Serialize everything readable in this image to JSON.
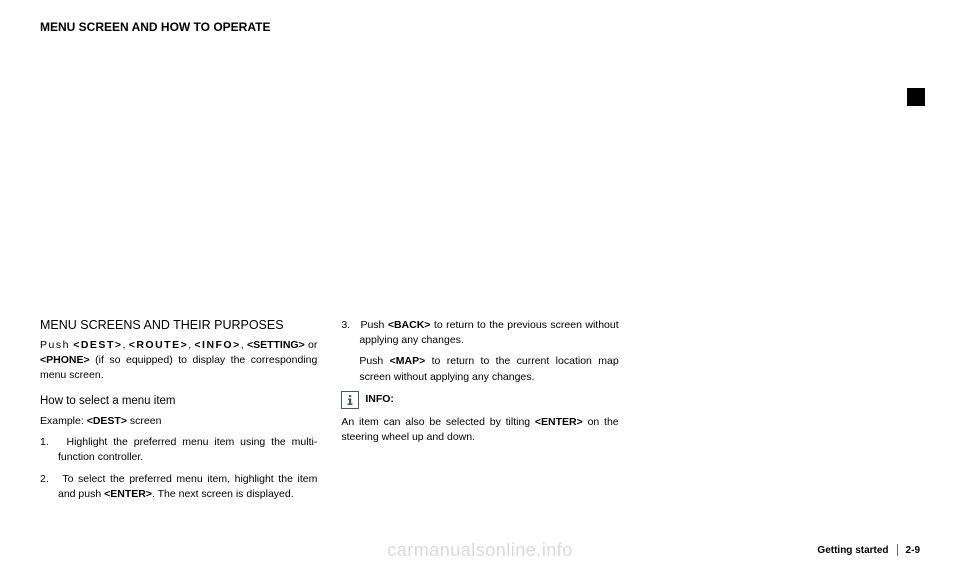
{
  "pageTitle": "MENU SCREEN AND HOW TO OPERATE",
  "col1": {
    "heading": "MENU SCREENS AND THEIR PURPOSES",
    "intro_push": "Push",
    "btn_dest": "<DEST>",
    "btn_route": "<ROUTE>",
    "btn_info": "<INFO>",
    "btn_setting": "<SETTING>",
    "intro_or": "or",
    "btn_phone": "<PHONE>",
    "intro_tail": "(if so equipped) to display the corresponding menu screen.",
    "howto_heading": "How to select a menu item",
    "example_prefix": "Example:",
    "example_btn": "<DEST>",
    "example_suffix": "screen",
    "step1_num": "1.",
    "step1_text": "Highlight the preferred menu item using the multi-function controller.",
    "step2_num": "2.",
    "step2_text_a": "To select the preferred menu item, highlight the item and push",
    "step2_btn": "<ENTER>",
    "step2_text_b": ". The next screen is displayed."
  },
  "col2": {
    "step3_num": "3.",
    "step3_text_a": "Push",
    "step3_btn_back": "<BACK>",
    "step3_text_b": "to return to the previous screen without applying any changes.",
    "step3_text_c": "Push",
    "step3_btn_map": "<MAP>",
    "step3_text_d": "to return to the current location map screen without applying any changes.",
    "info_label": "INFO:",
    "info_text_a": "An item can also be selected by tilting",
    "info_btn": "<ENTER>",
    "info_text_b": "on the steering wheel up and down."
  },
  "footer": {
    "section": "Getting started",
    "page": "2-9"
  },
  "watermark": "carmanualsonline.info"
}
